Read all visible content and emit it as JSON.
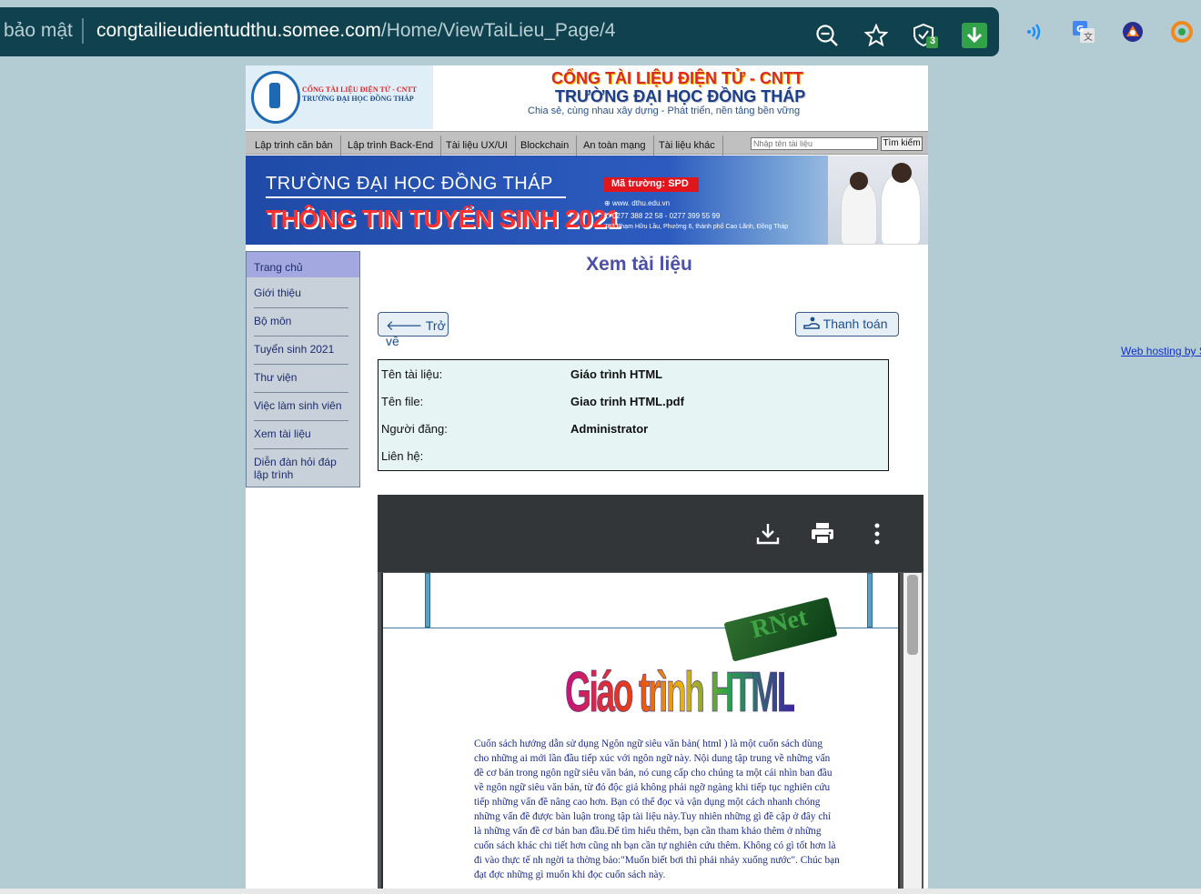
{
  "browser": {
    "security_label": "bảo mật",
    "url_host": "congtailieudientudthu.somee.com",
    "url_path": "/Home/ViewTaiLieu_Page/4",
    "shield_badge": "3"
  },
  "site_header": {
    "logo_line1": "CỔNG TÀI LIỆU ĐIỆN TỬ - CNTT",
    "logo_line2": "TRƯỜNG ĐẠI HỌC ĐỒNG THÁP",
    "title_line1": "CỔNG TÀI LIỆU ĐIỆN TỬ - CNTT",
    "title_line2": "TRƯỜNG ĐẠI HỌC ĐỒNG THÁP",
    "slogan": "Chia sẻ, cùng nhau xây dựng - Phát triển, nền tảng bền vững"
  },
  "nav": {
    "items": [
      "Lập trình căn bản",
      "Lập trình Back-End",
      "Tài liệu UX/UI",
      "Blockchain",
      "An toàn mạng",
      "Tài liệu khác"
    ],
    "search_placeholder": "Nhập tên tài liệu",
    "search_button": "Tìm kiếm"
  },
  "banner": {
    "line1": "TRƯỜNG ĐẠI HỌC ĐỒNG THÁP",
    "line2": "THÔNG TIN TUYỂN SINH 2021",
    "badge": "Mã trường: SPD",
    "website": "www. dthu.edu.vn",
    "phone": "0277 388 22 58  -  0277 399 55 99",
    "address": "783 Phạm Hữu Lầu, Phường 6, thành phố Cao Lãnh, Đồng Tháp"
  },
  "sidebar": {
    "items": [
      "Trang chủ",
      "Giới thiệu",
      "Bộ môn",
      "Tuyển sinh 2021",
      "Thư viện",
      "Việc làm sinh viên",
      "Xem tài liệu",
      "Diễn đàn hỏi đáp lập trình"
    ]
  },
  "main": {
    "title": "Xem tài liệu",
    "back_button": "Trở về",
    "pay_button": "Thanh toán",
    "info": {
      "labels": [
        "Tên tài liệu:",
        "Tên file:",
        "Người đăng:",
        "Liên hệ:"
      ],
      "values": [
        "Giáo trình HTML",
        "Giao trinh HTML.pdf",
        "Administrator",
        ""
      ]
    }
  },
  "pdf": {
    "wordart_title": "Giáo trình HTML",
    "logo_3d": "RNet",
    "body": "Cuốn sách hướng dẫn sử dụng Ngôn ngữ siêu văn bản( html ) là một cuốn sách dùng cho những ai mới lần đầu tiếp xúc với ngôn ngữ này. Nội dung tập trung về những vấn đề cơ bản trong ngôn ngữ siêu văn bản, nó cung cấp cho chúng ta một cái nhìn ban đầu về ngôn ngữ siêu văn bản, từ đó độc giả không phải ngỡ ngàng khi tiếp tục nghiên cứu tiếp những vấn đề nâng cao hơn. Bạn có thể đọc và vận dụng một cách nhanh chóng những vấn đề được bàn luận trong tập tài liệu này.Tuy nhiên những gì đề cập ở đây chỉ là những vấn đề cơ bản ban đầu.Để tìm hiểu thêm, bạn cần tham khảo thêm ở những cuốn sách khác chi tiết hơn cũng nh bạn cần tự nghiên cứu thêm. Không có gì tốt hơn là đi vào thực tế nh ngời ta thờng bảo:\"Muốn biết bơi thì phải nhảy xuống nước\". Chúc bạn đạt đợc những gì muốn khi đọc cuốn sách này."
  },
  "footer": {
    "webhost_link": "Web hosting by S"
  },
  "colors": {
    "browser_bar": "#0f414e",
    "page_bg": "#b3ccd3",
    "title_blue": "#4b4fa8",
    "sidebar_bg": "#c8d1da",
    "sidebar_active": "#a4a8e0",
    "info_bg": "#e6f4f3"
  }
}
